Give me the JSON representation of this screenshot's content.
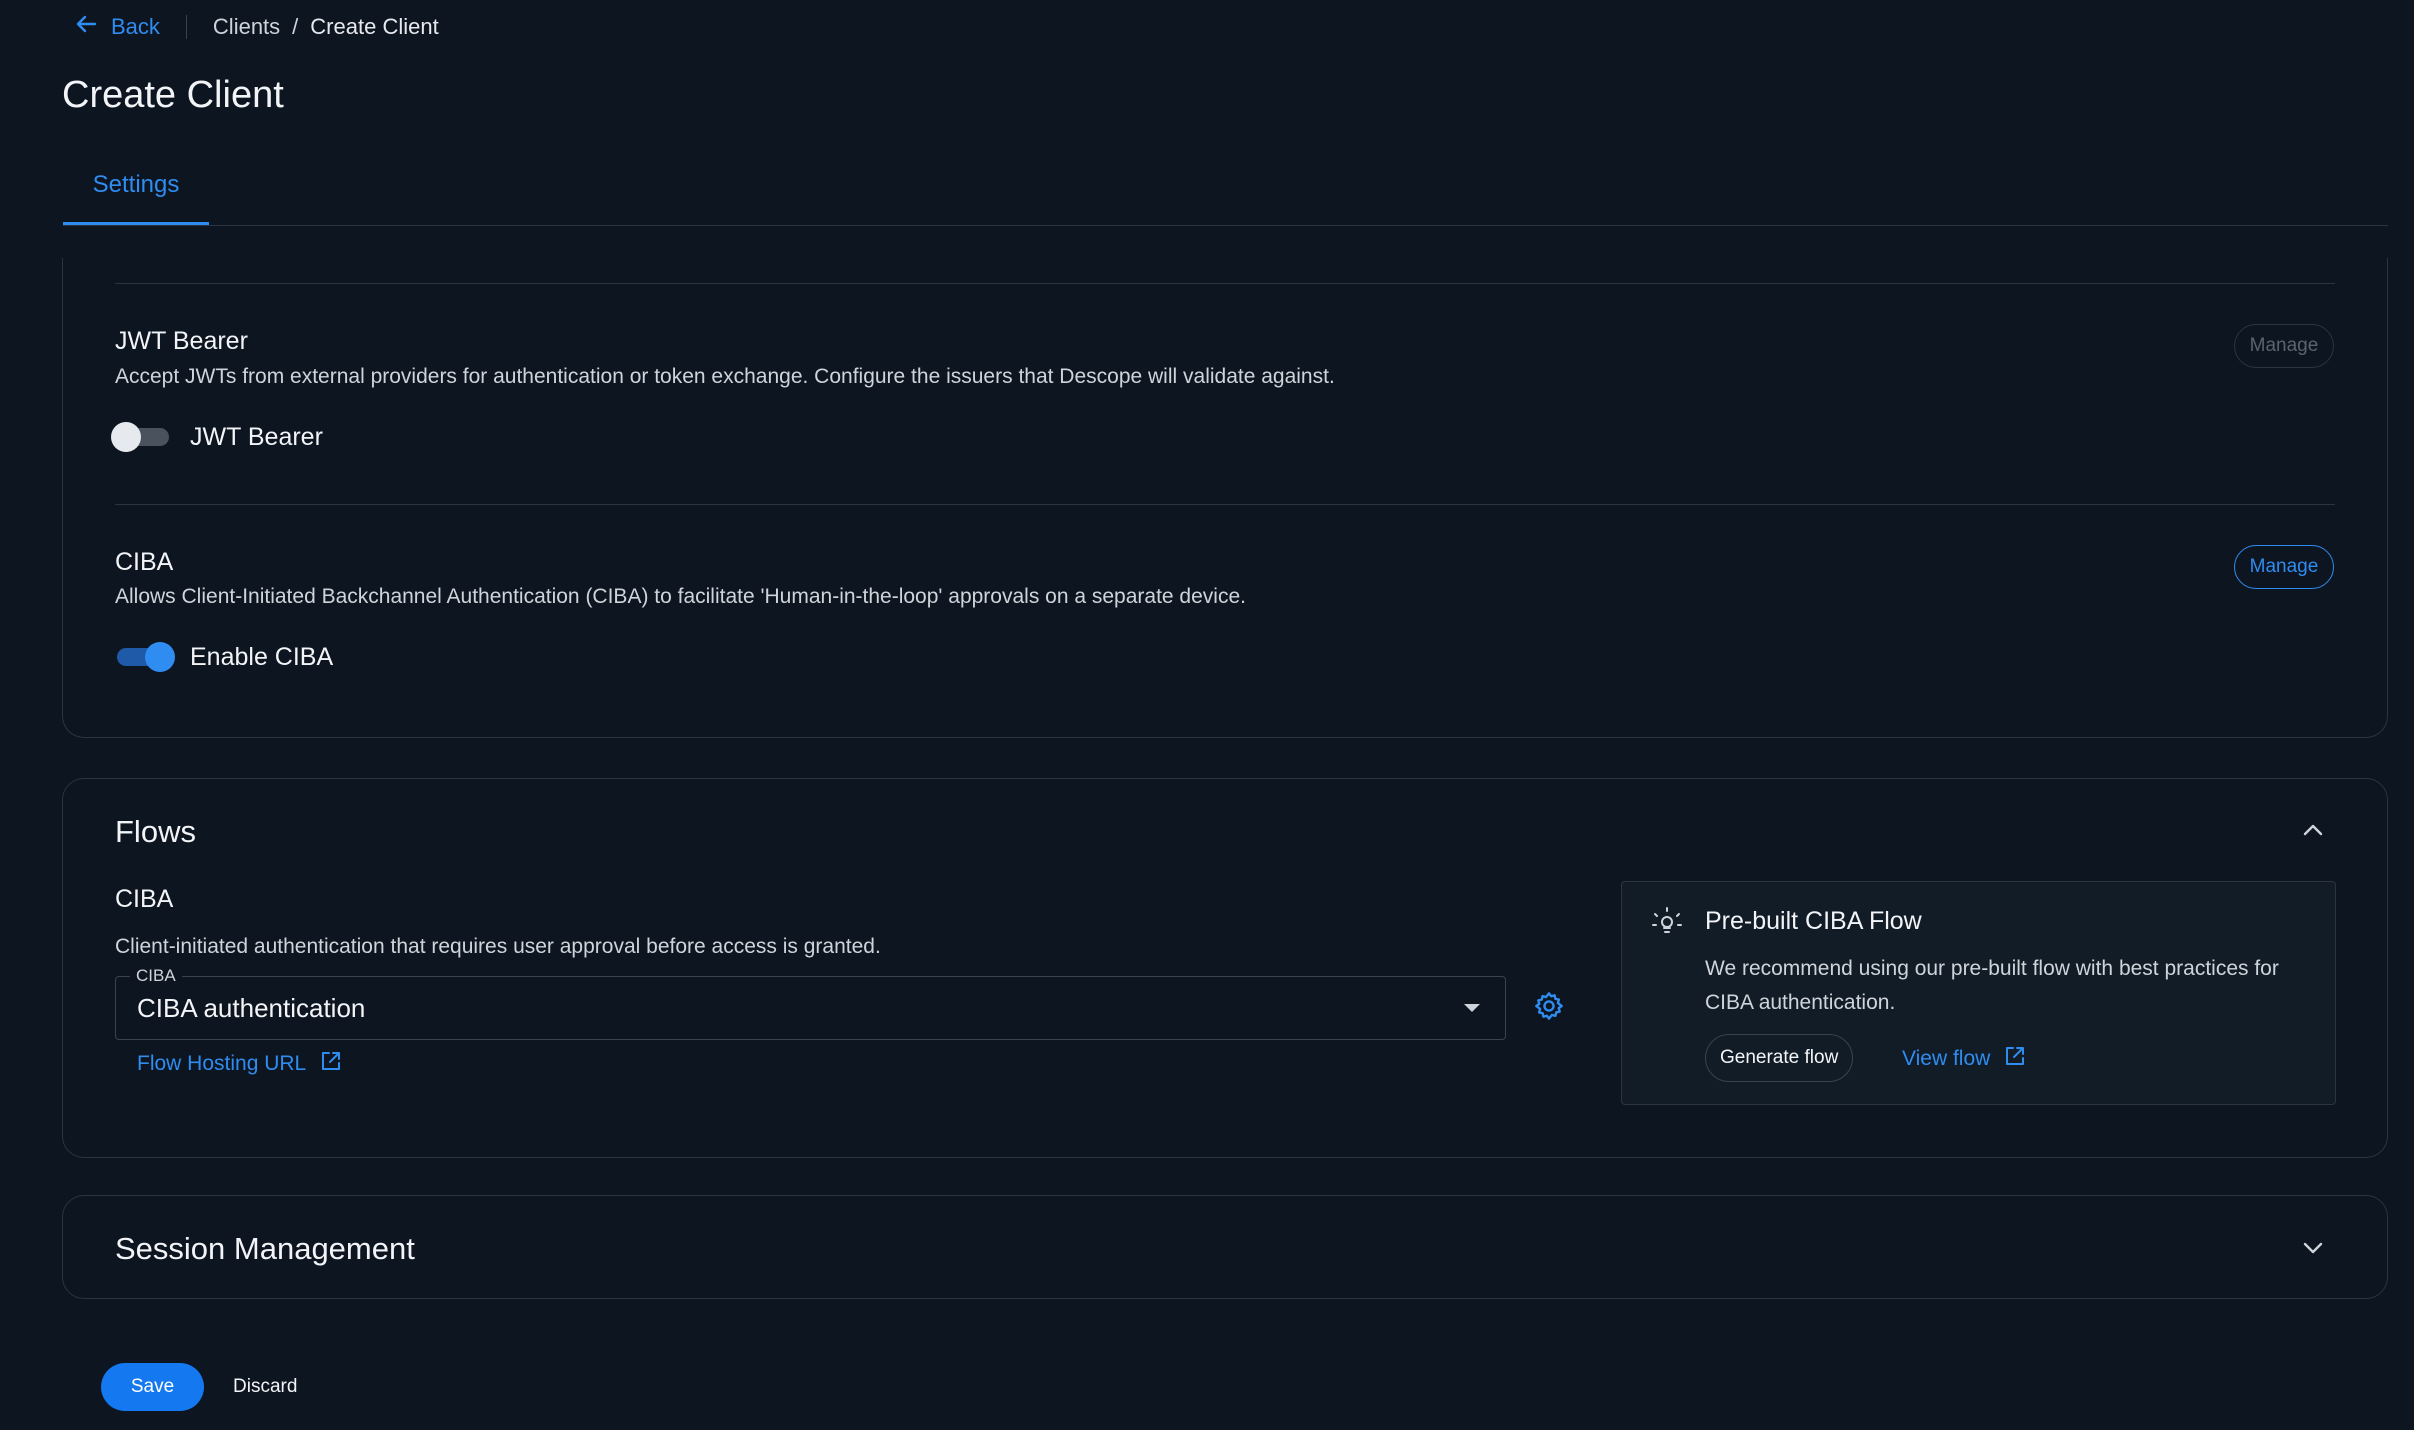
{
  "nav": {
    "back_label": "Back",
    "breadcrumb": [
      "Clients",
      "Create Client"
    ],
    "breadcrumb_separator": "/"
  },
  "page": {
    "title": "Create Client"
  },
  "tabs": [
    {
      "label": "Settings",
      "active": true
    }
  ],
  "jwt_bearer": {
    "title": "JWT Bearer",
    "description": "Accept JWTs from external providers for authentication or token exchange. Configure the issuers that Descope will validate against.",
    "manage_label": "Manage",
    "manage_enabled": false,
    "toggle_label": "JWT Bearer",
    "enabled": false
  },
  "ciba": {
    "title": "CIBA",
    "description": "Allows Client-Initiated Backchannel Authentication (CIBA) to facilitate 'Human-in-the-loop' approvals on a separate device.",
    "manage_label": "Manage",
    "manage_enabled": true,
    "toggle_label": "Enable CIBA",
    "enabled": true
  },
  "flows": {
    "title": "Flows",
    "expanded": true,
    "ciba_title": "CIBA",
    "ciba_description": "Client-initiated authentication that requires user approval before access is granted.",
    "select_legend": "CIBA",
    "select_value": "CIBA authentication",
    "hosting_link": "Flow Hosting URL",
    "prebuilt": {
      "title": "Pre-built CIBA Flow",
      "description": "We recommend using our pre-built flow with best practices for CIBA authentication.",
      "generate_label": "Generate flow",
      "view_label": "View flow"
    }
  },
  "session": {
    "title": "Session Management",
    "expanded": false
  },
  "actions": {
    "save_label": "Save",
    "discard_label": "Discard"
  },
  "colors": {
    "accent": "#2f8cf0",
    "background": "#0d1520",
    "border": "#2c3440"
  }
}
